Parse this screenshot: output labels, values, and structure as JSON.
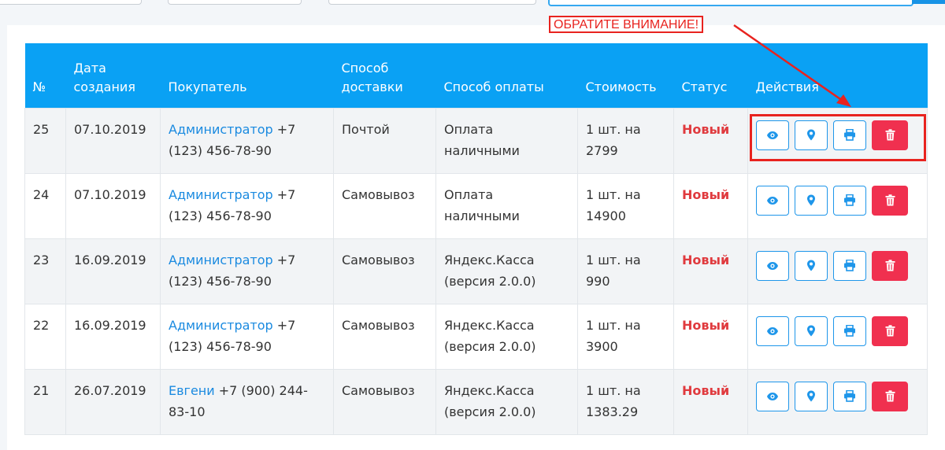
{
  "annotation": {
    "text": "ОБРАТИТЕ ВНИМАНИЕ!"
  },
  "table": {
    "headers": {
      "num": "№",
      "date_l1": "Дата",
      "date_l2": "создания",
      "buyer": "Покупатель",
      "delivery_l1": "Способ",
      "delivery_l2": "доставки",
      "payment": "Способ оплаты",
      "cost": "Стоимость",
      "status": "Статус",
      "actions": "Действия"
    },
    "rows": [
      {
        "id": "25",
        "date": "07.10.2019",
        "buyer_name": "Администратор",
        "buyer_phone_a": " +7",
        "buyer_phone_b": "(123) 456-78-90",
        "delivery": "Почтой",
        "payment_a": "Оплата",
        "payment_b": "наличными",
        "cost_a": "1 шт. на",
        "cost_b": "2799",
        "status": "Новый"
      },
      {
        "id": "24",
        "date": "07.10.2019",
        "buyer_name": "Администратор",
        "buyer_phone_a": " +7",
        "buyer_phone_b": "(123) 456-78-90",
        "delivery": "Самовывоз",
        "payment_a": "Оплата",
        "payment_b": "наличными",
        "cost_a": "1 шт. на",
        "cost_b": "14900",
        "status": "Новый"
      },
      {
        "id": "23",
        "date": "16.09.2019",
        "buyer_name": "Администратор",
        "buyer_phone_a": " +7",
        "buyer_phone_b": "(123) 456-78-90",
        "delivery": "Самовывоз",
        "payment_a": "Яндекс.Касса",
        "payment_b": "(версия 2.0.0)",
        "cost_a": "1 шт. на",
        "cost_b": "990",
        "status": "Новый"
      },
      {
        "id": "22",
        "date": "16.09.2019",
        "buyer_name": "Администратор",
        "buyer_phone_a": " +7",
        "buyer_phone_b": "(123) 456-78-90",
        "delivery": "Самовывоз",
        "payment_a": "Яндекс.Касса",
        "payment_b": "(версия 2.0.0)",
        "cost_a": "1 шт. на",
        "cost_b": "3900",
        "status": "Новый"
      },
      {
        "id": "21",
        "date": "26.07.2019",
        "buyer_name": "Евгени",
        "buyer_phone_a": " +7 (900) 244-",
        "buyer_phone_b": "83-10",
        "delivery": "Самовывоз",
        "payment_a": "Яндекс.Касса",
        "payment_b": "(версия 2.0.0)",
        "cost_a": "1 шт. на",
        "cost_b": "1383.29",
        "status": "Новый"
      }
    ]
  },
  "icons": [
    "eye-icon",
    "map-pin-icon",
    "printer-icon",
    "trash-icon"
  ],
  "colors": {
    "header": "#0aa1f4",
    "link": "#1a8ae0",
    "status": "#e03a3e",
    "delete": "#f0304f",
    "annotation": "#e8231f"
  }
}
